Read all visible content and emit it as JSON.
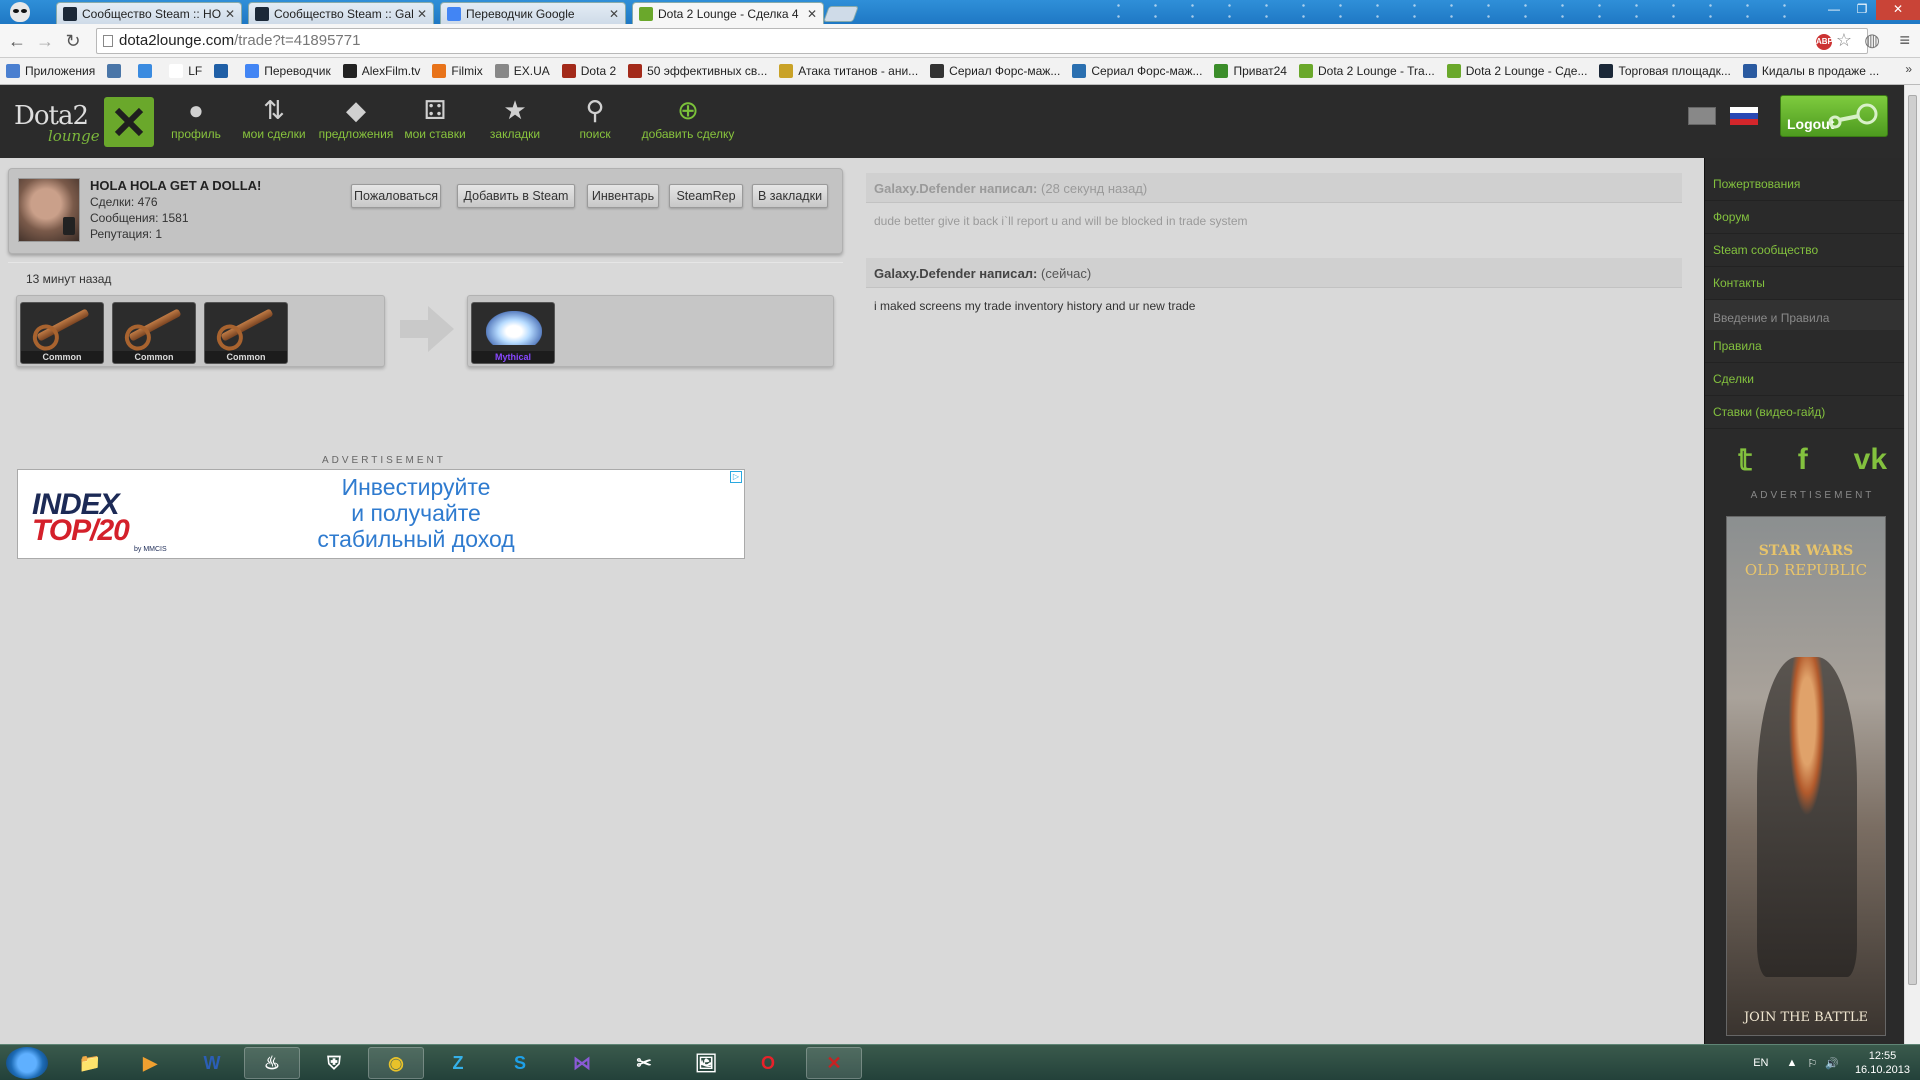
{
  "browser": {
    "tabs": [
      {
        "title": "Сообщество Steam :: HO",
        "favicon_color": "#1b2838"
      },
      {
        "title": "Сообщество Steam :: Gal",
        "favicon_color": "#1b2838"
      },
      {
        "title": "Переводчик Google",
        "favicon_color": "#4285f4"
      },
      {
        "title": "Dota 2 Lounge - Сделка 4",
        "favicon_color": "#6aa82b"
      }
    ],
    "url_host": "dota2lounge.com",
    "url_path": "/trade?t=41895771"
  },
  "bookmarks": [
    {
      "label": "Приложения",
      "icon_color": "#4a7fd0"
    },
    {
      "label": "",
      "icon_color": "#4a76a8"
    },
    {
      "label": "",
      "icon_color": "#3a8be0"
    },
    {
      "label": "LF",
      "icon_color": "#ffffff"
    },
    {
      "label": "",
      "icon_color": "#1f5fa6"
    },
    {
      "label": "Переводчик",
      "icon_color": "#4285f4"
    },
    {
      "label": "AlexFilm.tv",
      "icon_color": "#222222"
    },
    {
      "label": "Filmix",
      "icon_color": "#e8731a"
    },
    {
      "label": "EX.UA",
      "icon_color": "#888888"
    },
    {
      "label": "Dota 2",
      "icon_color": "#a32a1a"
    },
    {
      "label": "50 эффективных св...",
      "icon_color": "#a32a1a"
    },
    {
      "label": "Атака титанов - ани...",
      "icon_color": "#c9a227"
    },
    {
      "label": "Сериал Форс-маж...",
      "icon_color": "#333333"
    },
    {
      "label": "Сериал Форс-маж...",
      "icon_color": "#2a6fb0"
    },
    {
      "label": "Приват24",
      "icon_color": "#3b8d2a"
    },
    {
      "label": "Dota 2 Lounge - Tra...",
      "icon_color": "#6aa82b"
    },
    {
      "label": "Dota 2 Lounge - Сде...",
      "icon_color": "#6aa82b"
    },
    {
      "label": "Торговая площадк...",
      "icon_color": "#1b2838"
    },
    {
      "label": "Кидалы в продаже ...",
      "icon_color": "#2a5aa0"
    }
  ],
  "nav": [
    {
      "label": "профиль",
      "icon": "user-icon"
    },
    {
      "label": "мои сделки",
      "icon": "swap-icon"
    },
    {
      "label": "предложения",
      "icon": "tag-icon"
    },
    {
      "label": "мои ставки",
      "icon": "dice-icon"
    },
    {
      "label": "закладки",
      "icon": "star-icon"
    },
    {
      "label": "поиск",
      "icon": "search-icon"
    },
    {
      "label": "добавить сделку",
      "icon": "plus-circle-icon"
    }
  ],
  "logo": {
    "top": "Dota2",
    "bottom": "lounge"
  },
  "logout_label": "Logout",
  "profile": {
    "name": "HOLA HOLA GET A DOLLA!",
    "trades": "Сделки: 476",
    "messages": "Сообщения: 1581",
    "reputation": "Репутация: 1",
    "buttons": [
      "Пожаловаться",
      "Добавить в Steam",
      "Инвентарь",
      "SteamRep",
      "В закладки"
    ]
  },
  "trade": {
    "time_ago": "13 минут назад",
    "offer_items": [
      {
        "rarity": "Common",
        "rarity_color": "#dcdcdc"
      },
      {
        "rarity": "Common",
        "rarity_color": "#dcdcdc"
      },
      {
        "rarity": "Common",
        "rarity_color": "#dcdcdc"
      }
    ],
    "want_items": [
      {
        "rarity": "Mythical",
        "rarity_color": "#8847ff"
      }
    ]
  },
  "ad": {
    "label": "ADVERTISEMENT",
    "brand_line1": "INDEX",
    "brand_line2": "TOP/20",
    "brand_by": "by MMCIS",
    "copy_line1": "Инвестируйте",
    "copy_line2": "и получайте",
    "copy_line3": "стабильный доход"
  },
  "comments": [
    {
      "author": "Galaxy.Defender написал:",
      "time": "(28 секунд назад)",
      "text": "dude better give it back i`ll report u and will be blocked in trade system"
    },
    {
      "author": "Galaxy.Defender написал:",
      "time": "(сейчас)",
      "text": "i maked screens my trade inventory history and ur new trade"
    }
  ],
  "sidebar": {
    "links_top": [
      "Пожертвования",
      "Форум",
      "Steam сообщество",
      "Контакты"
    ],
    "section_title": "Введение и Правила",
    "links_bottom": [
      "Правила",
      "Сделки",
      "Ставки (видео-гайд)"
    ],
    "socials": [
      "twitter-icon",
      "facebook-icon",
      "vk-icon"
    ],
    "ad_label": "ADVERTISEMENT",
    "ad_title1": "STAR WARS",
    "ad_title2": "OLD REPUBLIC",
    "ad_cta": "JOIN THE BATTLE"
  },
  "taskbar": {
    "apps": [
      "explorer",
      "media-player",
      "word",
      "steam",
      "world-of-tanks",
      "chrome",
      "zona",
      "skype",
      "visual-studio",
      "tool",
      "paint",
      "opera",
      "dota2"
    ],
    "lang": "EN",
    "time": "12:55",
    "date": "16.10.2013"
  }
}
